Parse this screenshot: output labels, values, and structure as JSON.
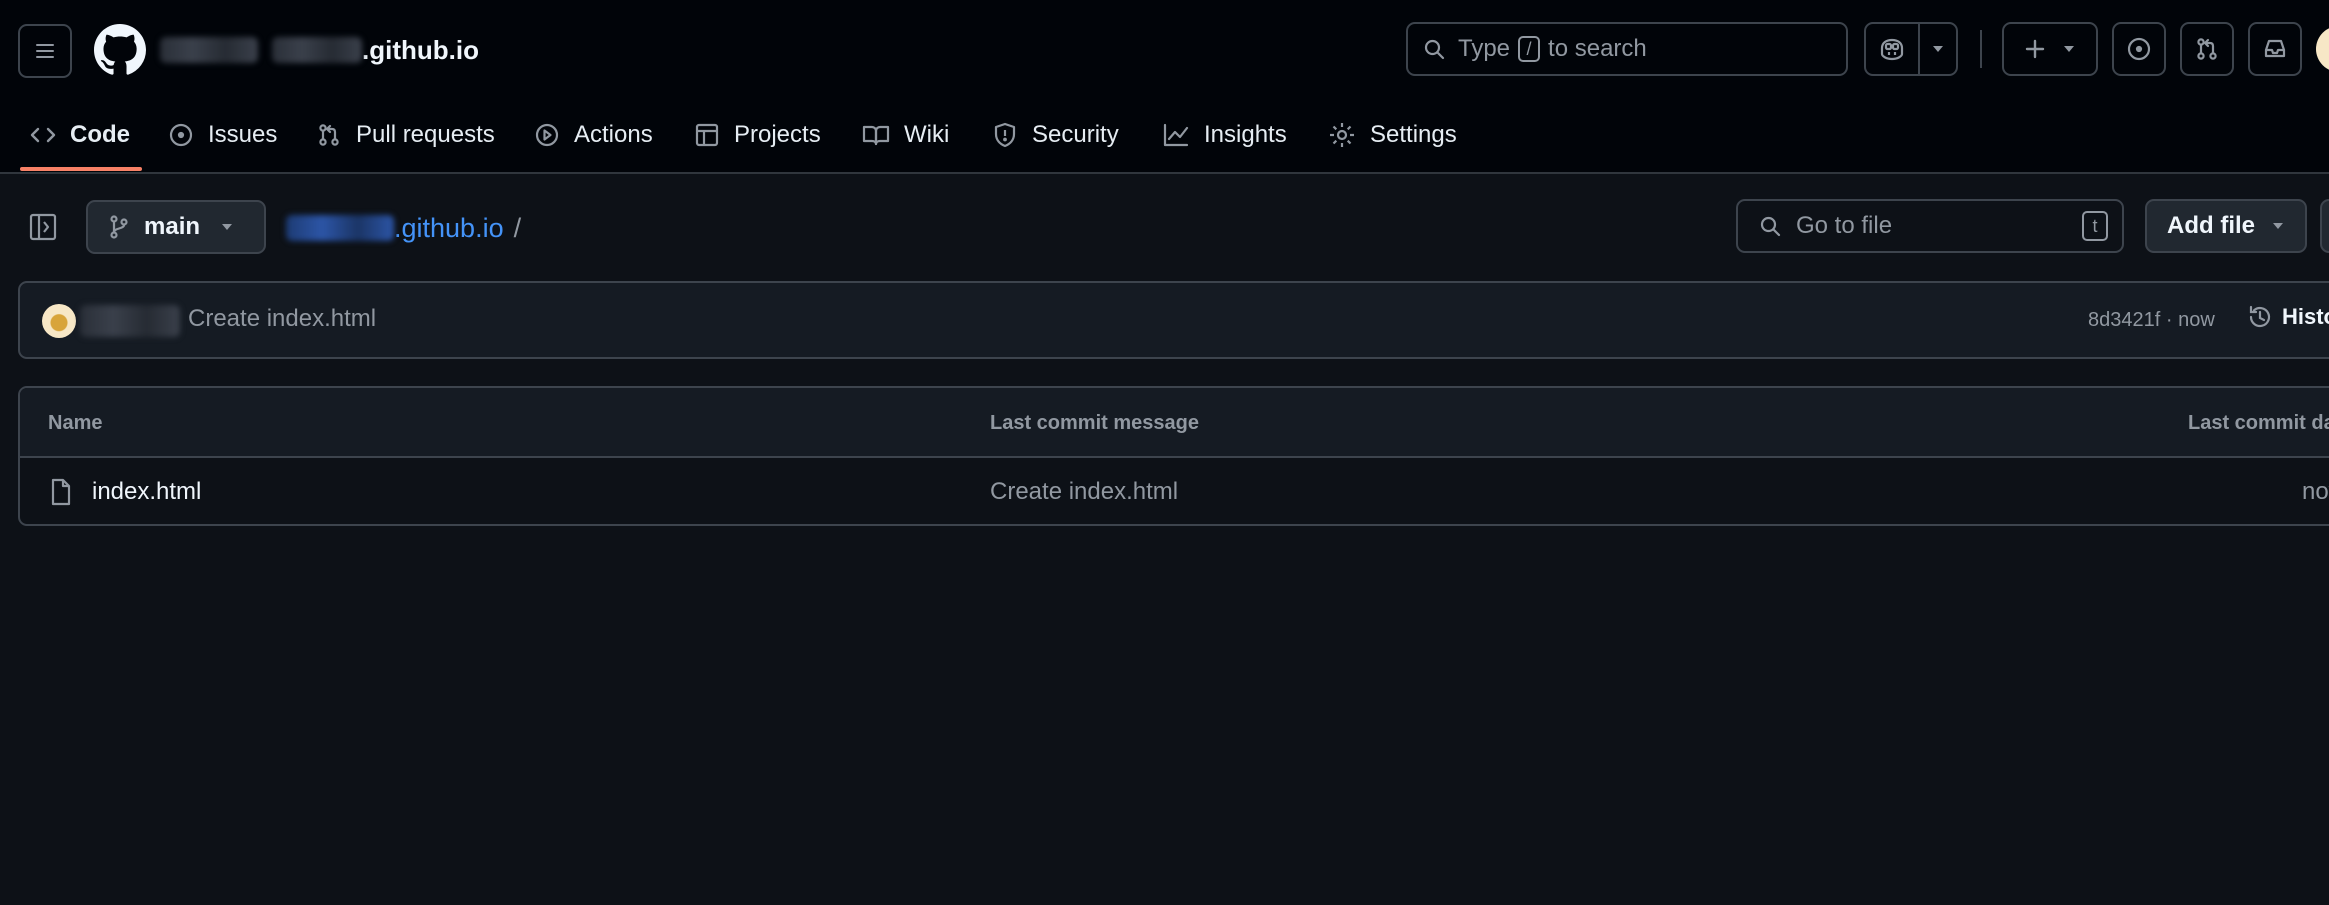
{
  "header": {
    "repo_suffix": ".github.io",
    "search_prefix": "Type",
    "search_key": "/",
    "search_suffix": "to search"
  },
  "tabs": [
    {
      "label": "Code",
      "icon": "code-icon",
      "active": true
    },
    {
      "label": "Issues",
      "icon": "issue-opened-icon"
    },
    {
      "label": "Pull requests",
      "icon": "git-pull-request-icon"
    },
    {
      "label": "Actions",
      "icon": "play-icon"
    },
    {
      "label": "Projects",
      "icon": "table-icon"
    },
    {
      "label": "Wiki",
      "icon": "book-icon"
    },
    {
      "label": "Security",
      "icon": "shield-icon"
    },
    {
      "label": "Insights",
      "icon": "graph-icon"
    },
    {
      "label": "Settings",
      "icon": "gear-icon"
    }
  ],
  "repo_bar": {
    "branch": "main",
    "breadcrumb_repo": ".github.io",
    "breadcrumb_sep": "/",
    "go_to_file_placeholder": "Go to file",
    "go_to_file_key": "t",
    "add_file_label": "Add file"
  },
  "latest_commit": {
    "message": "Create index.html",
    "meta": "8d3421f · now",
    "history_label": "History"
  },
  "file_table": {
    "columns": [
      "Name",
      "Last commit message",
      "Last commit date"
    ],
    "rows": [
      {
        "name": "index.html",
        "message": "Create index.html",
        "date": "now"
      }
    ]
  },
  "colors": {
    "background": "#0d1117",
    "header": "#010409",
    "accent_underline": "#f78166",
    "link": "#4493f8",
    "border": "#3d444d"
  }
}
